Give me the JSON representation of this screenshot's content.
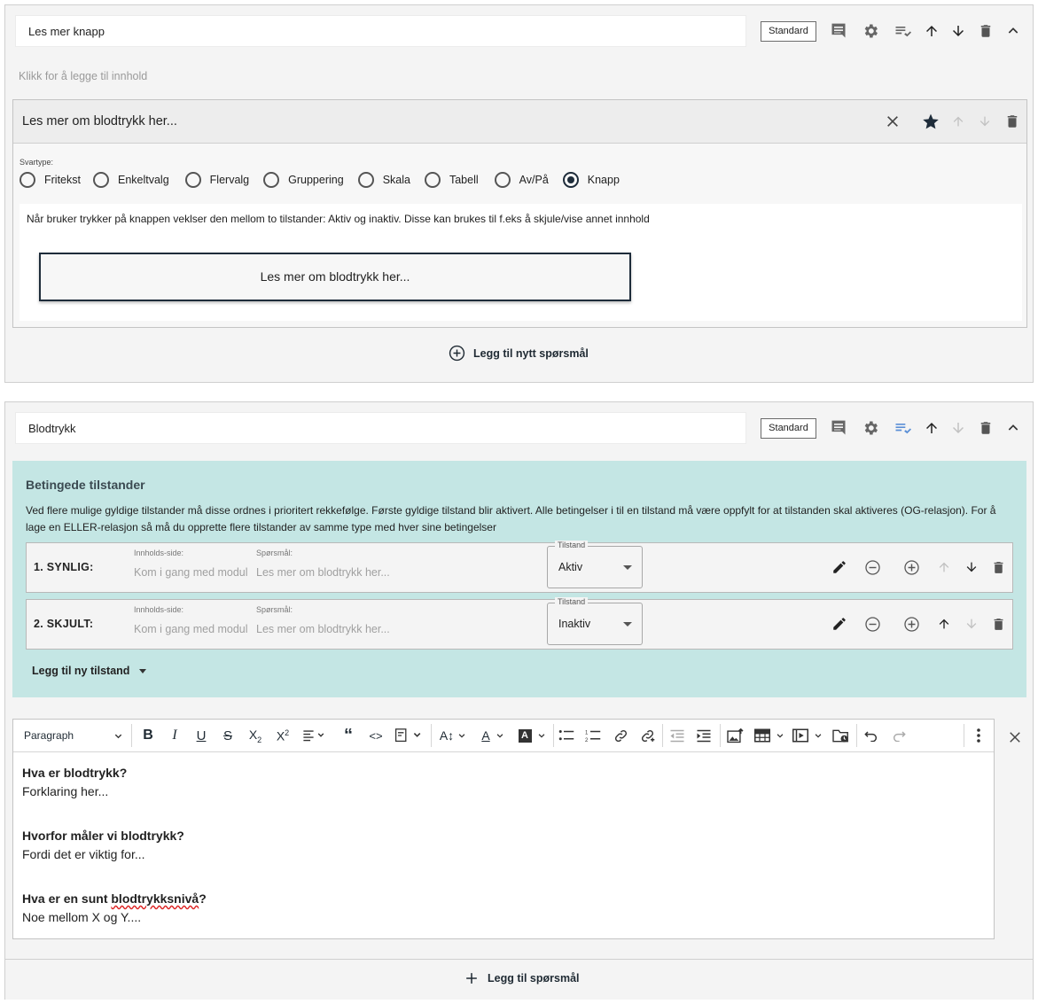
{
  "section1": {
    "title_value": "Les mer knapp",
    "badge": "Standard",
    "add_content": "Klikk for å legge til innhold",
    "question": {
      "title": "Les mer om blodtrykk her...",
      "svartype_label": "Svartype:",
      "answer_types": [
        "Fritekst",
        "Enkeltvalg",
        "Flervalg",
        "Gruppering",
        "Skala",
        "Tabell",
        "Av/På",
        "Knapp"
      ],
      "selected_type": "Knapp",
      "description": "Når bruker trykker på knappen veklser den mellom to tilstander: Aktiv og inaktiv. Disse kan brukes til f.eks å skjule/vise annet innhold",
      "button_preview": "Les mer om blodtrykk her..."
    },
    "add_question": "Legg til nytt spørsmål"
  },
  "section2": {
    "title_value": "Blodtrykk",
    "badge": "Standard",
    "conditions": {
      "title": "Betingede tilstander",
      "description": "Ved flere mulige gyldige tilstander må disse ordnes i prioritert rekkefølge. Første gyldige tilstand blir aktivert. Alle betingelser i til en tilstand må være oppfylt for at tilstanden skal aktiveres (OG-relasjon). For å lage en ELLER-relasjon så må du opprette flere tilstander av samme type med hver sine betingelser",
      "rows": [
        {
          "label": "1.  SYNLIG:",
          "page_label": "Innholds-side:",
          "page_value": "Kom i gang med modul",
          "question_label": "Spørsmål:",
          "question_value": "Les mer om blodtrykk her...",
          "state_label": "Tilstand",
          "state_value": "Aktiv"
        },
        {
          "label": "2.  SKJULT:",
          "page_label": "Innholds-side:",
          "page_value": "Kom i gang med modul",
          "question_label": "Spørsmål:",
          "question_value": "Les mer om blodtrykk her...",
          "state_label": "Tilstand",
          "state_value": "Inaktiv"
        }
      ],
      "add_state": "Legg til ny tilstand"
    },
    "editor": {
      "paragraph_select": "Paragraph",
      "content": [
        {
          "heading": "Hva er blodtrykk?",
          "text": "Forklaring her..."
        },
        {
          "heading": "Hvorfor måler vi blodtrykk?",
          "text": "Fordi det er viktig for..."
        },
        {
          "heading_pre": "Hva er en sunt ",
          "heading_spell": "blodtrykksnivå",
          "heading_post": "?",
          "text": "Noe mellom X og Y...."
        }
      ]
    },
    "add_question": "Legg til spørsmål"
  },
  "colors": {
    "accent_dark": "#1e2c3a",
    "condition_bg": "#c4e6e4",
    "toolbar_active": "#5b8fd6"
  }
}
